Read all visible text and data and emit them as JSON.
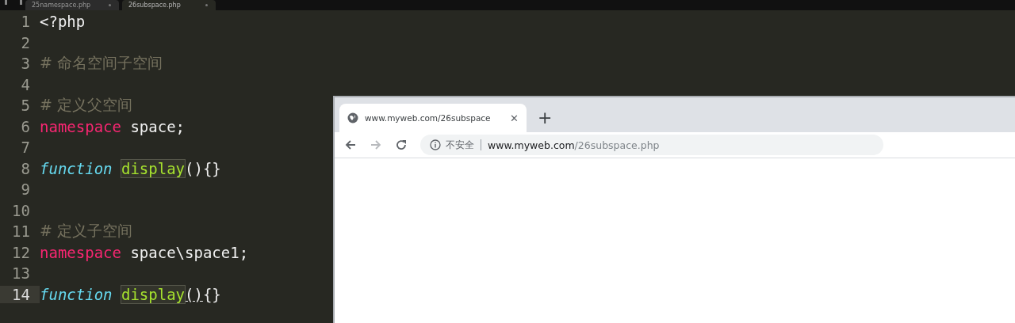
{
  "editor": {
    "tabs": [
      {
        "label": "25namespace.php",
        "selected": false
      },
      {
        "label": "26subspace.php",
        "selected": true
      }
    ],
    "lines": [
      {
        "number": "1",
        "current": false,
        "tokens": [
          {
            "kind": "plain",
            "text": "<?php"
          }
        ]
      },
      {
        "number": "2",
        "current": false
      },
      {
        "number": "3",
        "current": false,
        "tokens": [
          {
            "kind": "comment",
            "text": "# 命名空间子空间"
          }
        ]
      },
      {
        "number": "4",
        "current": false
      },
      {
        "number": "5",
        "current": false,
        "tokens": [
          {
            "kind": "comment",
            "text": "# 定义父空间"
          }
        ]
      },
      {
        "number": "6",
        "current": false,
        "tokens": [
          {
            "kind": "keyword",
            "text": "namespace"
          },
          {
            "kind": "plain",
            "text": " space;"
          }
        ]
      },
      {
        "number": "7",
        "current": false
      },
      {
        "number": "8",
        "current": false,
        "tokens": [
          {
            "kind": "storage",
            "text": "function "
          },
          {
            "kind": "name",
            "text": "display"
          },
          {
            "kind": "plain",
            "text": "(){}"
          }
        ]
      },
      {
        "number": "9",
        "current": false
      },
      {
        "number": "10",
        "current": false
      },
      {
        "number": "11",
        "current": false,
        "tokens": [
          {
            "kind": "comment",
            "text": "# 定义子空间"
          }
        ]
      },
      {
        "number": "12",
        "current": false,
        "tokens": [
          {
            "kind": "keyword",
            "text": "namespace"
          },
          {
            "kind": "plain",
            "text": " space\\space1;"
          }
        ]
      },
      {
        "number": "13",
        "current": false
      },
      {
        "number": "14",
        "current": true,
        "tokens": [
          {
            "kind": "storage",
            "text": "function "
          },
          {
            "kind": "name",
            "text": "display"
          },
          {
            "kind": "bracket",
            "text": "()"
          },
          {
            "kind": "plain",
            "text": "{}"
          }
        ]
      }
    ]
  },
  "browser": {
    "tab": {
      "title": "www.myweb.com/26subspace",
      "close": "✕"
    },
    "new_tab": "+",
    "address": {
      "security": "不安全",
      "host": "www.myweb.com",
      "path": "/26subspace.php"
    }
  }
}
